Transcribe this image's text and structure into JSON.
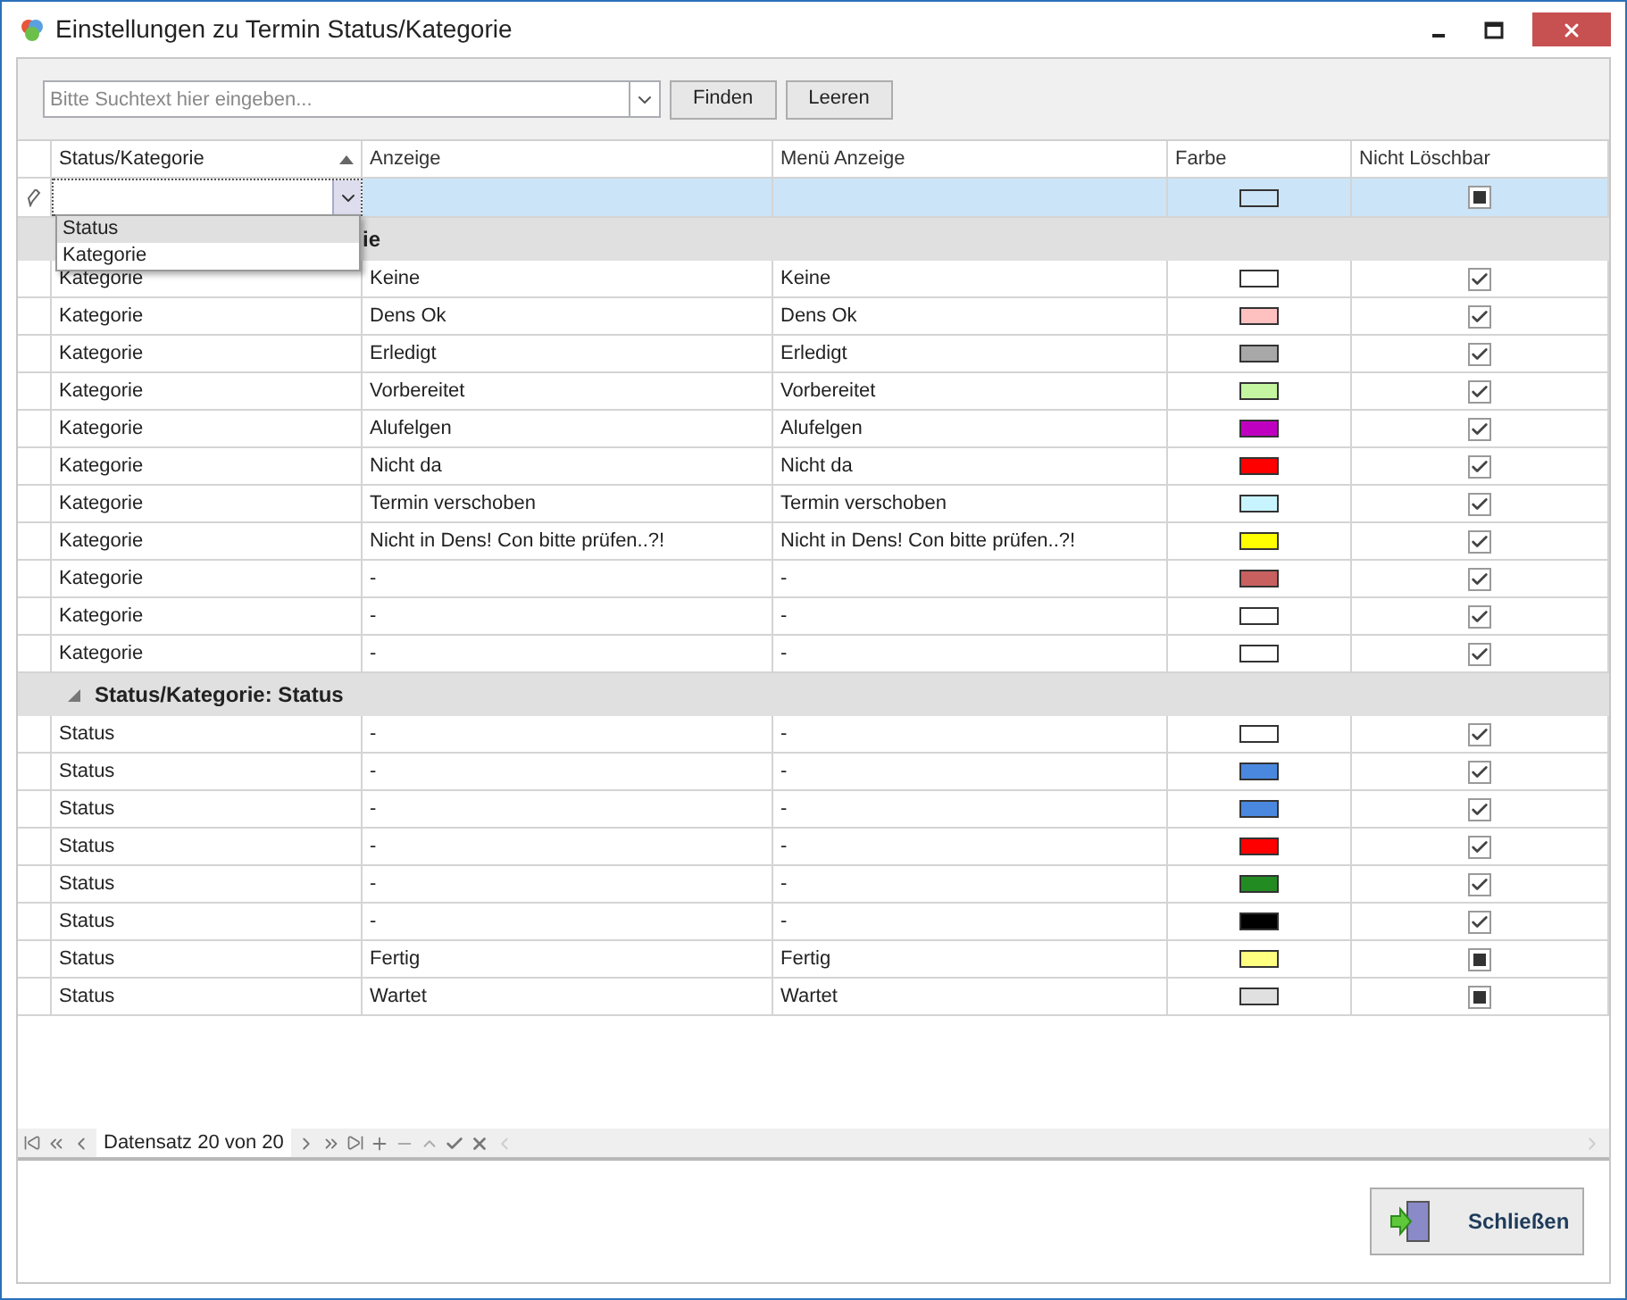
{
  "window": {
    "title": "Einstellungen zu Termin Status/Kategorie"
  },
  "search": {
    "placeholder": "Bitte Suchtext hier eingeben...",
    "buttons": [
      "Finden",
      "Leeren"
    ]
  },
  "table": {
    "columns": [
      {
        "label": "Status/Kategorie",
        "sorted": true
      },
      {
        "label": "Anzeige",
        "sorted": false
      },
      {
        "label": "Menü Anzeige",
        "sorted": false
      },
      {
        "label": "Farbe",
        "sorted": false
      },
      {
        "label": "Nicht Löschbar",
        "sorted": false
      }
    ],
    "new_row": {
      "color": "#cce4f7",
      "checked": false
    },
    "editor_dropdown": {
      "options": [
        {
          "label": "Status",
          "selected": true
        },
        {
          "label": "Kategorie",
          "selected": false
        }
      ]
    },
    "groups": [
      {
        "kind": "covered",
        "title": "ie",
        "expanded": true,
        "rows": [
          {
            "type": "Kategorie",
            "anzeige": "Keine",
            "menu": "Keine",
            "color": "#ffffff",
            "checked": true
          },
          {
            "type": "Kategorie",
            "anzeige": "Dens Ok",
            "menu": "Dens Ok",
            "color": "#ffc0c0",
            "checked": true
          },
          {
            "type": "Kategorie",
            "anzeige": "Erledigt",
            "menu": "Erledigt",
            "color": "#a8a8a8",
            "checked": true
          },
          {
            "type": "Kategorie",
            "anzeige": "Vorbereitet",
            "menu": "Vorbereitet",
            "color": "#c4f5a0",
            "checked": true
          },
          {
            "type": "Kategorie",
            "anzeige": "Alufelgen",
            "menu": "Alufelgen",
            "color": "#c000c0",
            "checked": true
          },
          {
            "type": "Kategorie",
            "anzeige": "Nicht da",
            "menu": "Nicht da",
            "color": "#ff0000",
            "checked": true
          },
          {
            "type": "Kategorie",
            "anzeige": "Termin verschoben",
            "menu": "Termin verschoben",
            "color": "#c8f4ff",
            "checked": true
          },
          {
            "type": "Kategorie",
            "anzeige": "Nicht in Dens! Con bitte prüfen..?!",
            "menu": "Nicht in Dens! Con bitte prüfen..?!",
            "color": "#ffff00",
            "checked": true
          },
          {
            "type": "Kategorie",
            "anzeige": "-",
            "menu": "-",
            "color": "#c86060",
            "checked": true
          },
          {
            "type": "Kategorie",
            "anzeige": "-",
            "menu": "-",
            "color": "#ffffff",
            "checked": true
          },
          {
            "type": "Kategorie",
            "anzeige": "-",
            "menu": "-",
            "color": "#ffffff",
            "checked": true
          }
        ]
      },
      {
        "kind": "full",
        "title": "Status/Kategorie: Status",
        "expanded": true,
        "rows": [
          {
            "type": "Status",
            "anzeige": "-",
            "menu": "-",
            "color": "#ffffff",
            "checked": true
          },
          {
            "type": "Status",
            "anzeige": "-",
            "menu": "-",
            "color": "#4a88e0",
            "checked": true
          },
          {
            "type": "Status",
            "anzeige": "-",
            "menu": "-",
            "color": "#4a88e0",
            "checked": true
          },
          {
            "type": "Status",
            "anzeige": "-",
            "menu": "-",
            "color": "#ff0000",
            "checked": true
          },
          {
            "type": "Status",
            "anzeige": "-",
            "menu": "-",
            "color": "#228b22",
            "checked": true
          },
          {
            "type": "Status",
            "anzeige": "-",
            "menu": "-",
            "color": "#000000",
            "checked": true
          },
          {
            "type": "Status",
            "anzeige": "Fertig",
            "menu": "Fertig",
            "color": "#ffff80",
            "checked": false
          },
          {
            "type": "Status",
            "anzeige": "Wartet",
            "menu": "Wartet",
            "color": "#e0e0e0",
            "checked": false
          }
        ]
      }
    ]
  },
  "navigator": {
    "record_text": "Datensatz 20 von 20"
  },
  "footer": {
    "close_button": "Schließen"
  }
}
